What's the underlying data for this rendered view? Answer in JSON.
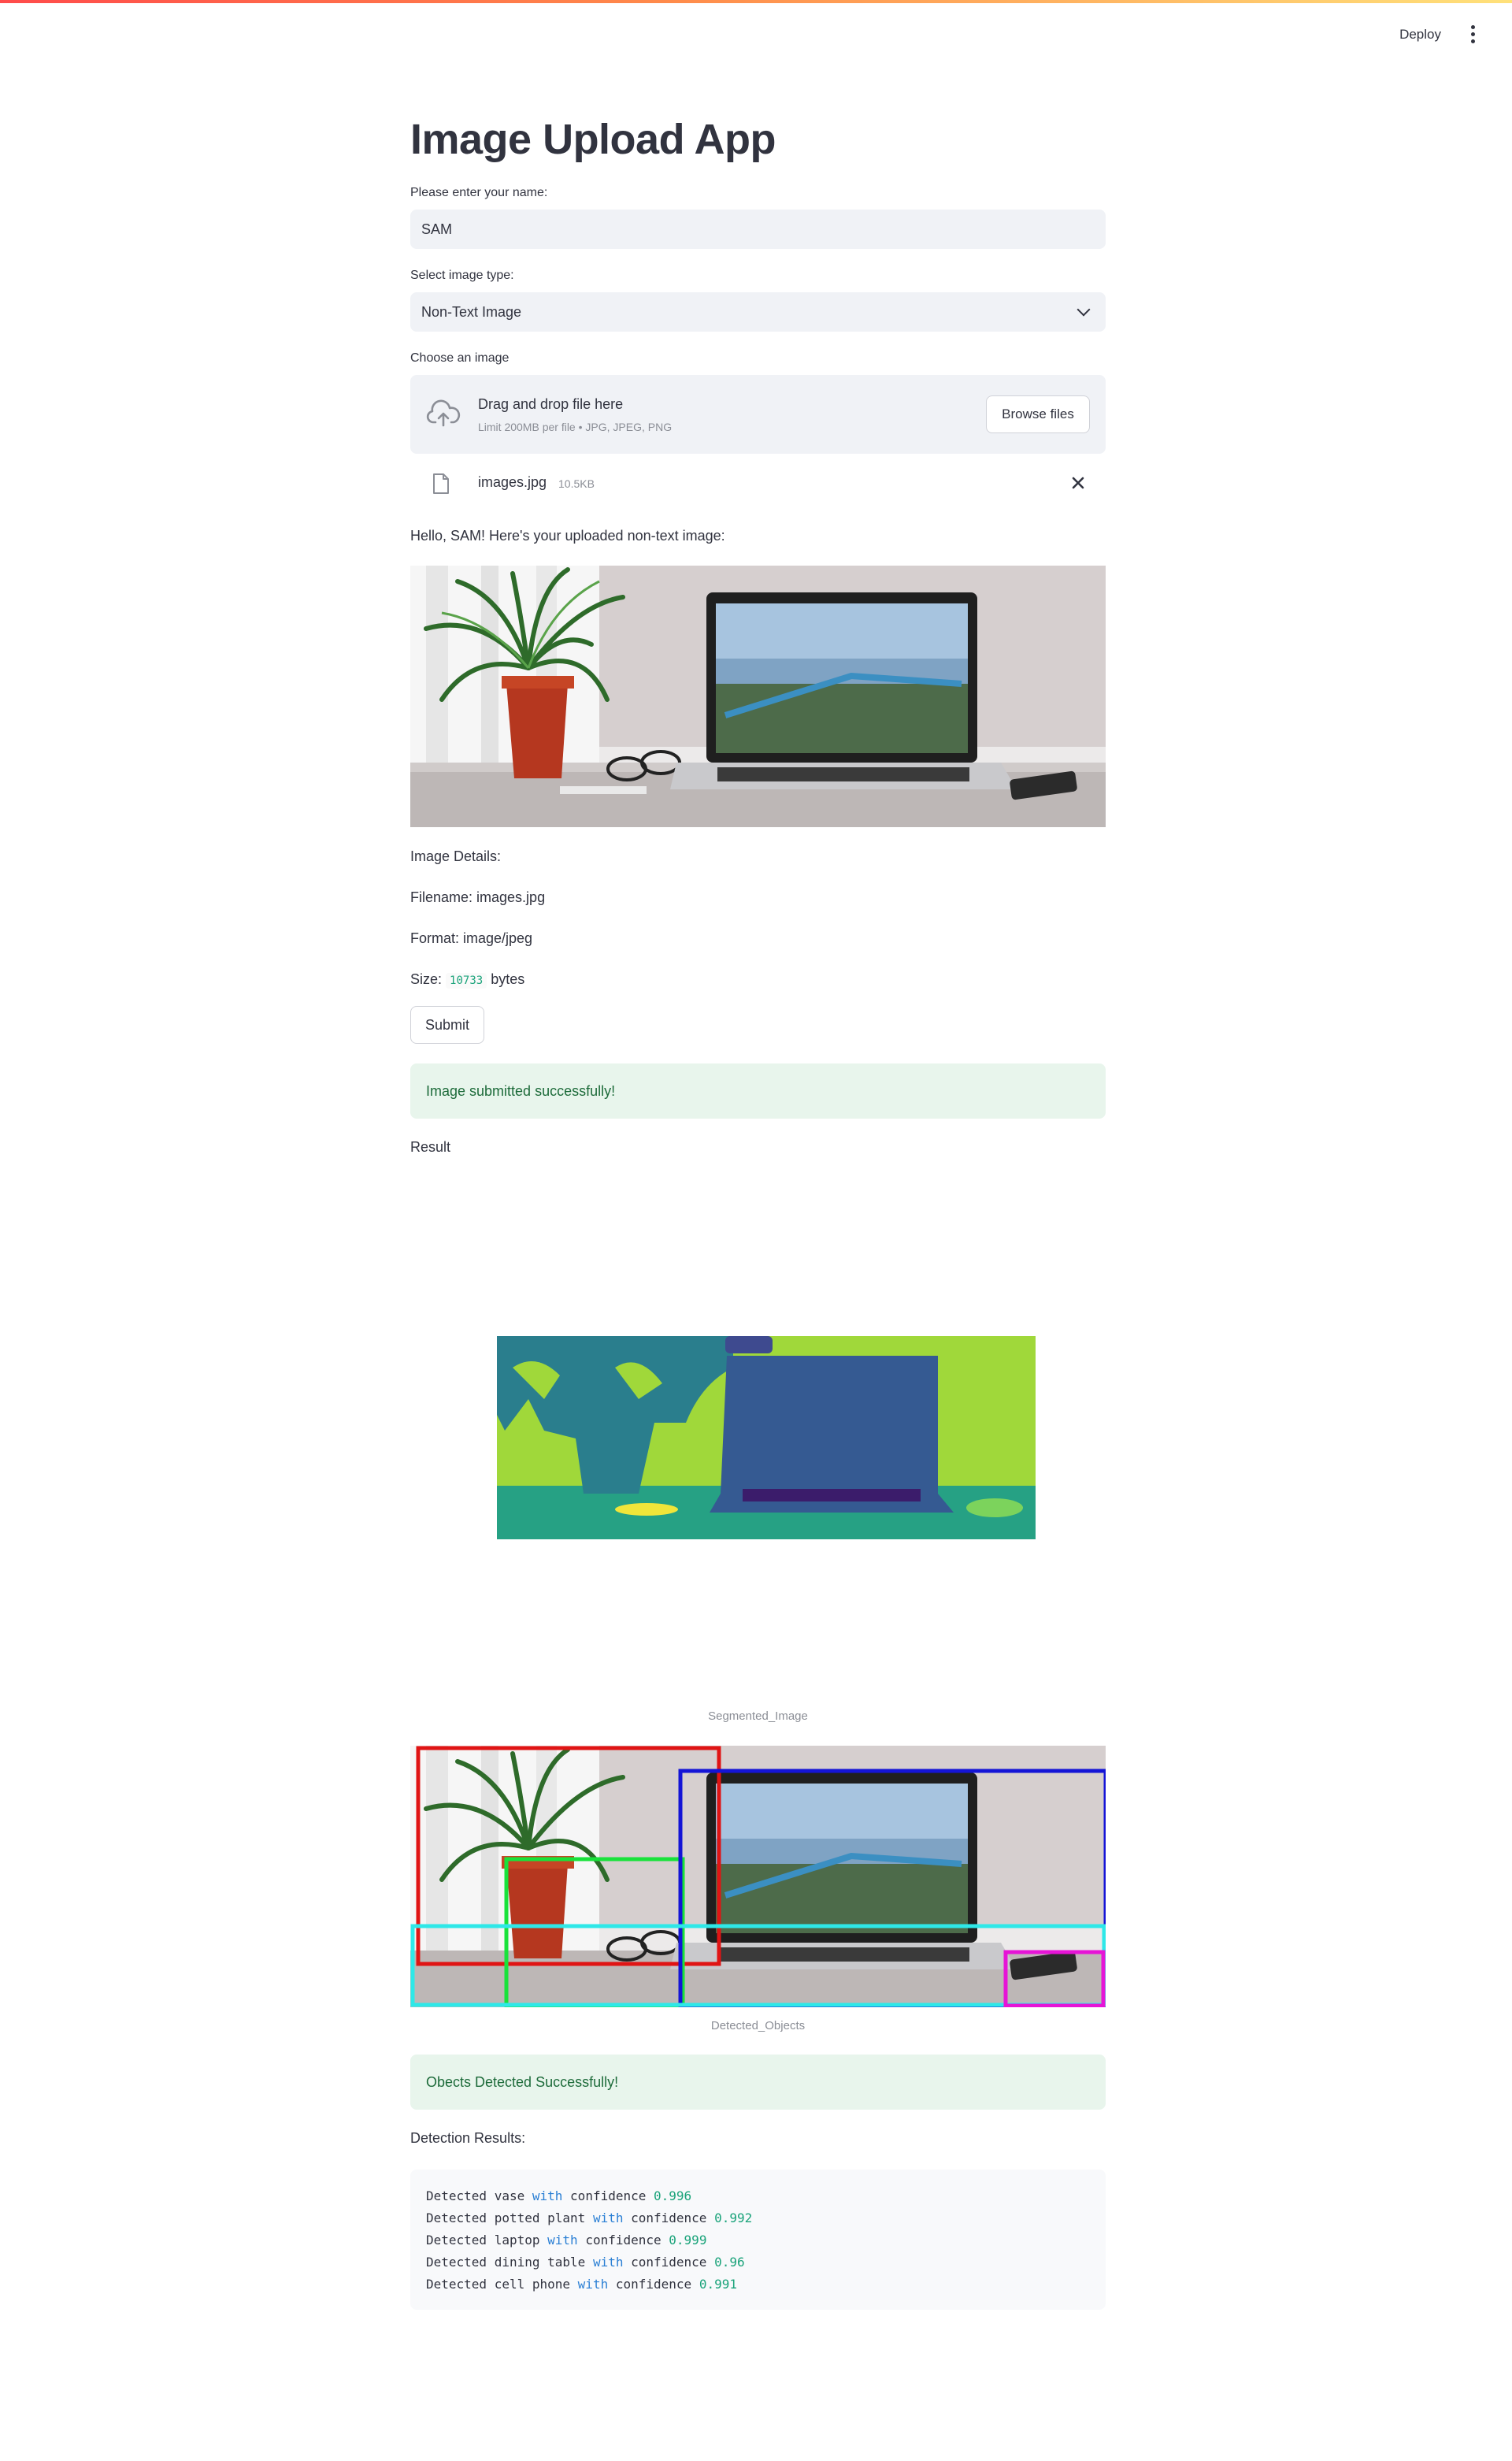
{
  "header": {
    "deploy_label": "Deploy",
    "menu_icon": "kebab-menu-icon"
  },
  "page": {
    "title": "Image Upload App"
  },
  "form": {
    "name_label": "Please enter your name:",
    "name_value": "SAM",
    "type_label": "Select image type:",
    "type_value": "Non-Text Image",
    "upload_label": "Choose an image",
    "dropzone_title": "Drag and drop file here",
    "dropzone_sub": "Limit 200MB per file • JPG, JPEG, PNG",
    "browse_label": "Browse files",
    "file_name": "images.jpg",
    "file_size": "10.5KB"
  },
  "greeting": "Hello, SAM! Here's your uploaded non-text image:",
  "details": {
    "heading": "Image Details:",
    "filename": "Filename: images.jpg",
    "format": "Format: image/jpeg",
    "size_prefix": "Size:",
    "size_value": "10733",
    "size_suffix": "bytes"
  },
  "submit_label": "Submit",
  "success_message": "Image submitted successfully!",
  "result_label": "Result",
  "segmented_caption": "Segmented_Image",
  "detected_caption": "Detected_Objects",
  "objects_message": "Obects Detected Successfully!",
  "detection_heading": "Detection Results:",
  "detections": [
    {
      "prefix": "Detected vase",
      "kw": "with",
      "mid": "confidence",
      "conf": "0.996"
    },
    {
      "prefix": "Detected potted plant",
      "kw": "with",
      "mid": "confidence",
      "conf": "0.992"
    },
    {
      "prefix": "Detected laptop",
      "kw": "with",
      "mid": "confidence",
      "conf": "0.999"
    },
    {
      "prefix": "Detected dining table",
      "kw": "with",
      "mid": "confidence",
      "conf": "0.96"
    },
    {
      "prefix": "Detected cell phone",
      "kw": "with",
      "mid": "confidence",
      "conf": "0.991"
    }
  ],
  "colors": {
    "accent": "#ff4b4b",
    "success_bg": "#e8f5ec",
    "success_text": "#1d6b3a",
    "input_bg": "#f0f2f6"
  }
}
